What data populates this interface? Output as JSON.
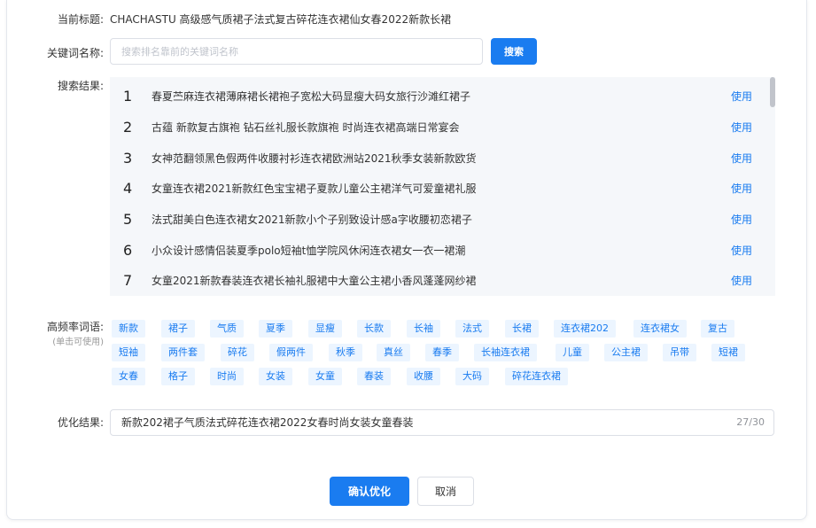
{
  "colors": {
    "accent": "#1a7cf0",
    "tag_bg": "#ecf5ff",
    "results_bg": "#f5f7fa"
  },
  "current_title": {
    "label": "当前标题:",
    "value": "CHACHASTU 高级感气质裙子法式复古碎花连衣裙仙女春2022新款长裙"
  },
  "keyword": {
    "label": "关键词名称:",
    "placeholder": "搜索排名靠前的关键词名称",
    "value": "",
    "search_label": "搜索"
  },
  "results": {
    "label": "搜索结果:",
    "use_label": "使用",
    "items": [
      {
        "rank": "1",
        "text": "春夏苎麻连衣裙薄麻裙长裙袍子宽松大码显瘦大码女旅行沙滩红裙子"
      },
      {
        "rank": "2",
        "text": "古蕴 新款复古旗袍 钻石丝礼服长款旗袍 时尚连衣裙高端日常宴会"
      },
      {
        "rank": "3",
        "text": "女神范翻领黑色假两件收腰衬衫连衣裙欧洲站2021秋季女装新款欧货"
      },
      {
        "rank": "4",
        "text": "女童连衣裙2021新款红色宝宝裙子夏款儿童公主裙洋气可爱童裙礼服"
      },
      {
        "rank": "5",
        "text": "法式甜美白色连衣裙女2021新款小个子别致设计感a字收腰初恋裙子"
      },
      {
        "rank": "6",
        "text": "小众设计感情侣装夏季polo短袖t恤学院风休闲连衣裙女一衣一裙潮"
      },
      {
        "rank": "7",
        "text": "女童2021新款春装连衣裙长袖礼服裙中大童公主裙小香风蓬蓬网纱裙"
      }
    ]
  },
  "frequent": {
    "label": "高频率词语:",
    "hint": "(单击可使用)",
    "tags": [
      "新款",
      "裙子",
      "气质",
      "夏季",
      "显瘦",
      "长款",
      "长袖",
      "法式",
      "长裙",
      "连衣裙202",
      "连衣裙女",
      "复古",
      "短袖",
      "两件套",
      "碎花",
      "假两件",
      "秋季",
      "真丝",
      "春季",
      "长袖连衣裙",
      "儿童",
      "公主裙",
      "吊带",
      "短裙",
      "女春",
      "格子",
      "时尚",
      "女装",
      "女童",
      "春装",
      "收腰",
      "大码",
      "碎花连衣裙"
    ]
  },
  "optimized": {
    "label": "优化结果:",
    "value": "新款202裙子气质法式碎花连衣裙2022女春时尚女装女童春装",
    "count": "27/30"
  },
  "actions": {
    "confirm_label": "确认优化",
    "cancel_label": "取消"
  }
}
